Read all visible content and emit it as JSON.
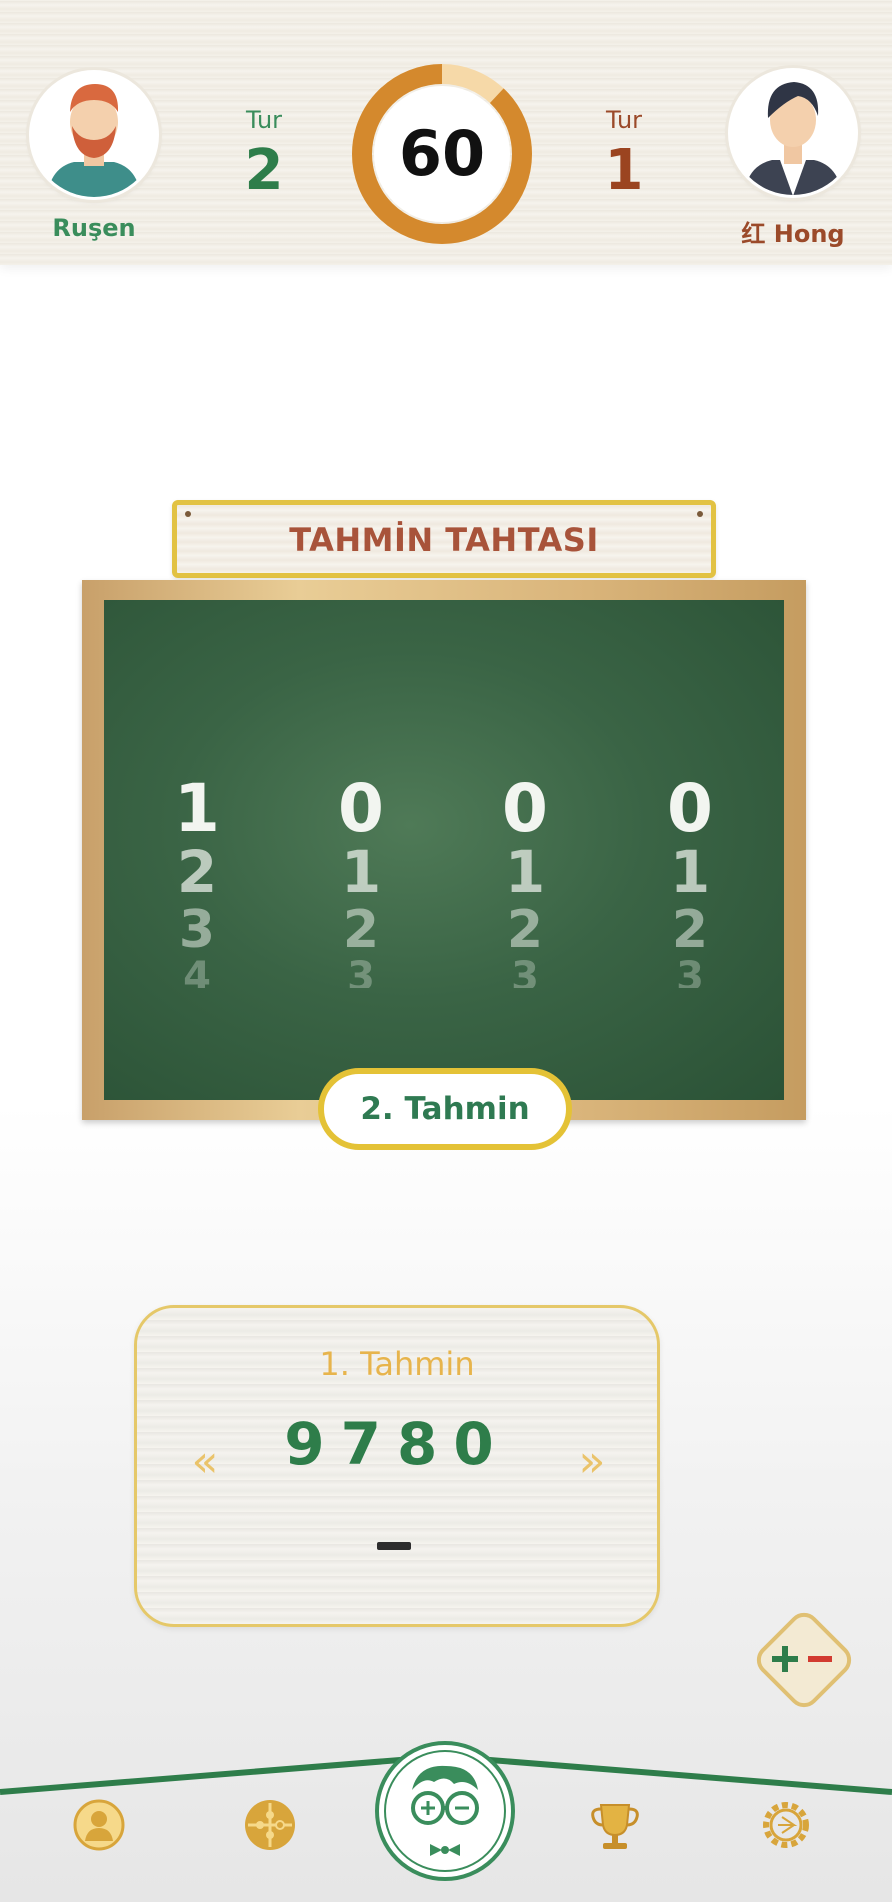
{
  "header": {
    "player_left": {
      "name": "Ruşen",
      "round_label": "Tur",
      "round_value": "2"
    },
    "player_right": {
      "name": "红 Hong",
      "round_label": "Tur",
      "round_value": "1"
    },
    "timer": {
      "value": "60",
      "remaining_fraction": 0.88
    }
  },
  "board": {
    "title": "TAHMİN TAHTASI",
    "columns": [
      {
        "digits": [
          "1",
          "2",
          "3",
          "4"
        ]
      },
      {
        "digits": [
          "0",
          "1",
          "2",
          "3"
        ]
      },
      {
        "digits": [
          "0",
          "1",
          "2",
          "3"
        ]
      },
      {
        "digits": [
          "0",
          "1",
          "2",
          "3"
        ]
      }
    ],
    "guess_label": "2. Tahmin"
  },
  "history": {
    "title": "1. Tahmin",
    "value": "9780",
    "prev_arrow": "«",
    "next_arrow": "»",
    "result": "–"
  },
  "nav": {
    "items": [
      "profile-icon",
      "puzzle-icon",
      "center-mascot-icon",
      "trophy-icon",
      "settings-icon"
    ]
  },
  "colors": {
    "green": "#2e7d4a",
    "brown": "#9b4420",
    "gold": "#e4c236",
    "chalkboard": "#3a6445"
  }
}
